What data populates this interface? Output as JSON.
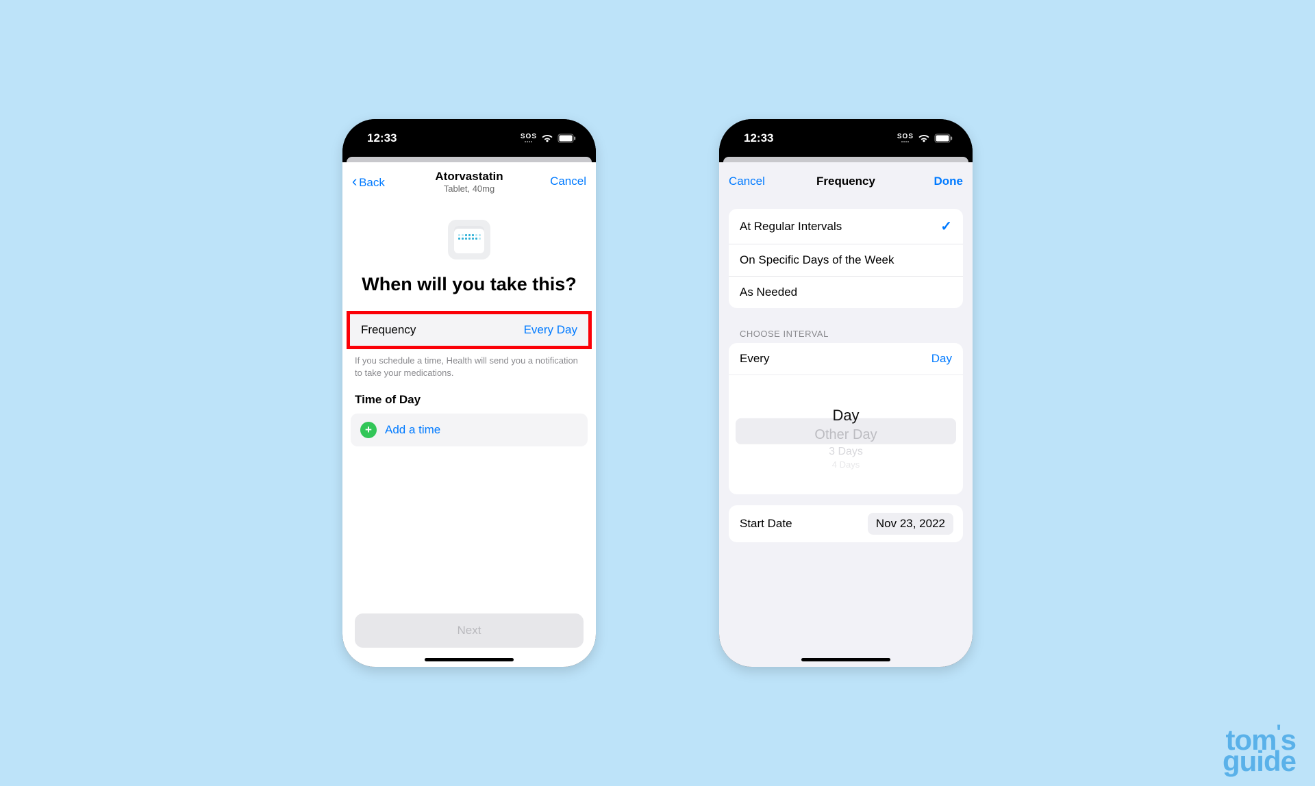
{
  "status": {
    "time": "12:33",
    "sos": "SOS"
  },
  "left": {
    "nav": {
      "back": "Back",
      "title": "Atorvastatin",
      "subtitle": "Tablet, 40mg",
      "cancel": "Cancel"
    },
    "headline": "When will you take this?",
    "frequency": {
      "label": "Frequency",
      "value": "Every Day"
    },
    "hint": "If you schedule a time, Health will send you a notification to take your medications.",
    "time_section": "Time of Day",
    "add_time": "Add a time",
    "next": "Next"
  },
  "right": {
    "nav": {
      "cancel": "Cancel",
      "title": "Frequency",
      "done": "Done"
    },
    "options": {
      "regular": "At Regular Intervals",
      "specific": "On Specific Days of the Week",
      "needed": "As Needed"
    },
    "choose_header": "CHOOSE INTERVAL",
    "interval": {
      "label": "Every",
      "value": "Day"
    },
    "picker": {
      "selected": "Day",
      "near": "Other Day",
      "far": "3 Days",
      "veryfar": "4 Days"
    },
    "start": {
      "label": "Start Date",
      "value": "Nov 23, 2022"
    }
  },
  "watermark": {
    "line1": "tom",
    "apos": "'",
    "s": "s",
    "line2": "guide"
  }
}
